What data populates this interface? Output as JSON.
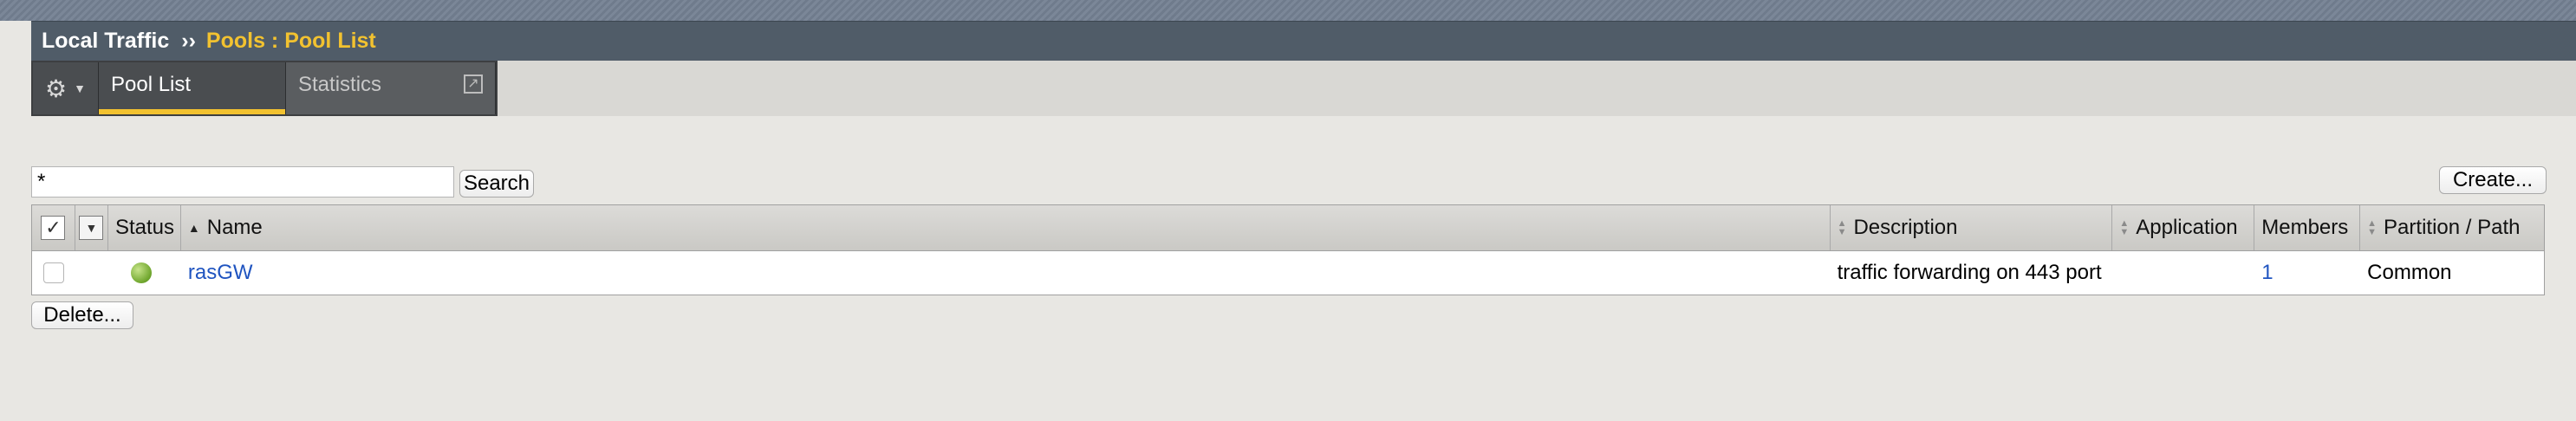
{
  "breadcrumb": {
    "root": "Local Traffic",
    "separator": "››",
    "current": "Pools : Pool List"
  },
  "tabs": {
    "gear_icon": "gear-icon",
    "items": [
      {
        "label": "Pool List",
        "active": true
      },
      {
        "label": "Statistics",
        "active": false,
        "icon": "popout-icon"
      }
    ]
  },
  "search": {
    "value": "*",
    "button_label": "Search"
  },
  "actions": {
    "create_label": "Create...",
    "delete_label": "Delete..."
  },
  "table": {
    "columns": [
      "Status",
      "Name",
      "Description",
      "Application",
      "Members",
      "Partition / Path"
    ],
    "rows": [
      {
        "status": "available",
        "name": "rasGW",
        "description": "traffic forwarding on 443 port",
        "application": "",
        "members": "1",
        "partition": "Common"
      }
    ]
  },
  "colors": {
    "header_bar": "#505c68",
    "accent": "#f2c230",
    "link": "#1f54c0",
    "status_available": "#6ea52c"
  }
}
